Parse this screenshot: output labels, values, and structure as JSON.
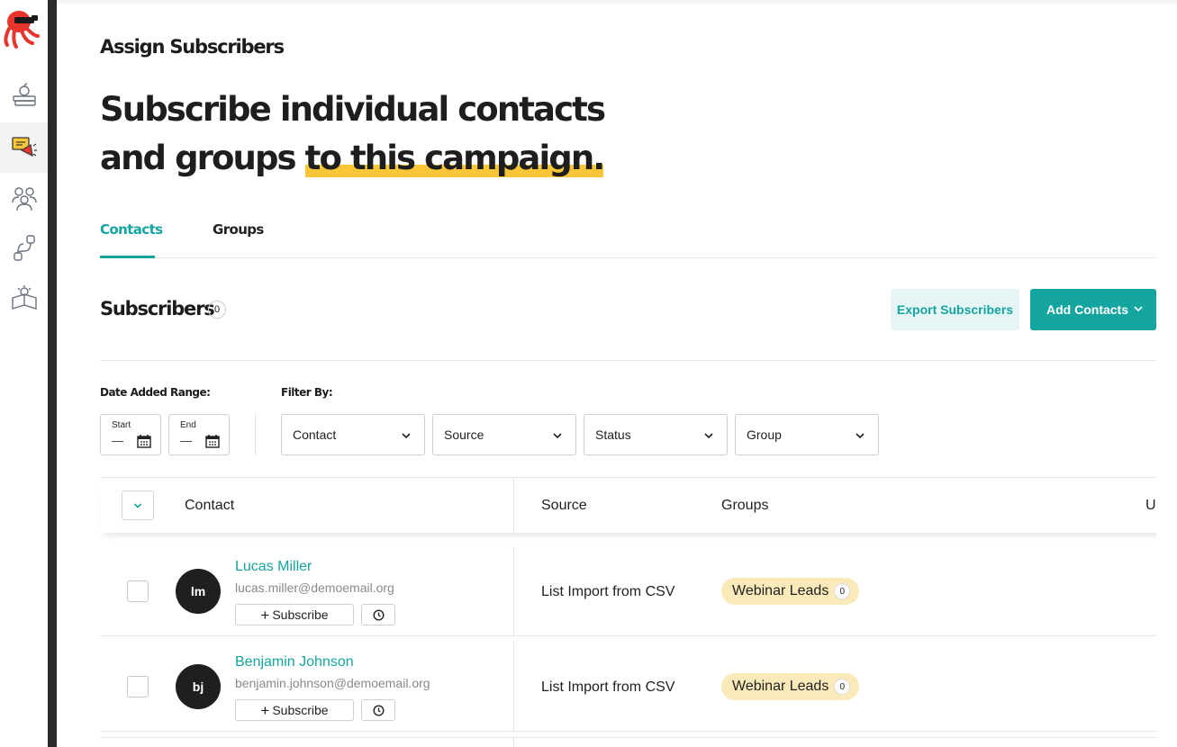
{
  "page": {
    "eyebrow": "Assign Subscribers",
    "headline_part1": "Subscribe individual contacts and groups ",
    "headline_highlight": "to this campaign."
  },
  "tabs": [
    {
      "label": "Contacts",
      "active": true
    },
    {
      "label": "Groups",
      "active": false
    }
  ],
  "subscribers": {
    "title": "Subscribers",
    "count": "0",
    "export_label": "Export Subscribers",
    "add_label": "Add Contacts"
  },
  "filters": {
    "date_range_label": "Date Added Range:",
    "start_label": "Start",
    "start_value": "—",
    "end_label": "End",
    "end_value": "—",
    "filter_by_label": "Filter By:",
    "selects": [
      "Contact",
      "Source",
      "Status",
      "Group"
    ]
  },
  "table": {
    "headers": [
      "Contact",
      "Source",
      "Groups",
      "U"
    ],
    "rows": [
      {
        "initials": "lm",
        "name": "Lucas Miller",
        "email": "lucas.miller@demoemail.org",
        "subscribe_label": "Subscribe",
        "source": "List Import from CSV",
        "group": "Webinar Leads",
        "group_count": "0"
      },
      {
        "initials": "bj",
        "name": "Benjamin Johnson",
        "email": "benjamin.johnson@demoemail.org",
        "subscribe_label": "Subscribe",
        "source": "List Import from CSV",
        "group": "Webinar Leads",
        "group_count": "0"
      }
    ]
  },
  "sidebar": {
    "icons": [
      "logo-icon",
      "apple-books-icon",
      "megaphone-icon",
      "people-icon",
      "integrations-icon",
      "learning-icon"
    ],
    "active": "megaphone-icon"
  },
  "colors": {
    "accent": "#15a5a0",
    "highlight": "#f9c637",
    "tag_bg": "#fbeab9",
    "sidebar_edge": "#2a2a2a"
  }
}
